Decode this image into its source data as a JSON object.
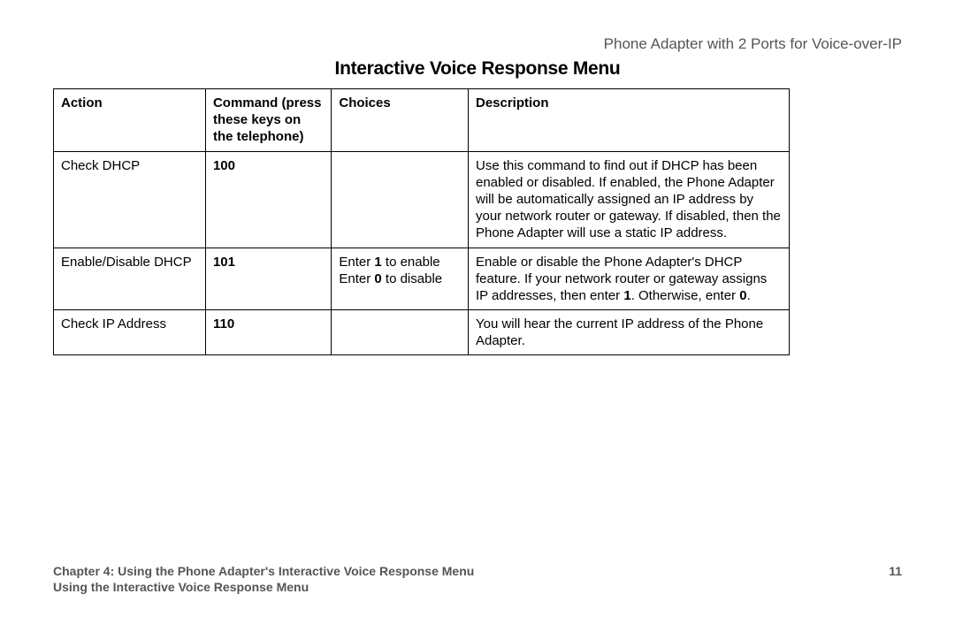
{
  "header": {
    "product": "Phone Adapter with 2 Ports for Voice-over-IP"
  },
  "title": "Interactive Voice Response Menu",
  "table": {
    "headers": {
      "action": "Action",
      "command": "Command (press these keys on the telephone)",
      "choices": "Choices",
      "description": "Description"
    },
    "rows": [
      {
        "action": "Check DHCP",
        "command": "100",
        "choices": "",
        "description": "Use this command to find out if DHCP has been enabled or disabled. If enabled, the Phone Adapter will be automatically assigned an IP address by your network router or gateway. If disabled, then the Phone Adapter will use a static IP address."
      },
      {
        "action": "Enable/Disable DHCP",
        "command": "101",
        "choices_parts": {
          "pre1": "Enter ",
          "b1": "1",
          "post1": " to enable\nEnter ",
          "b2": "0",
          "post2": " to disable"
        },
        "description_parts": {
          "pre": "Enable or disable the Phone Adapter's DHCP feature. If your network router or gateway assigns IP addresses, then enter ",
          "b1": "1",
          "mid": ". Otherwise, enter ",
          "b2": "0",
          "end": "."
        }
      },
      {
        "action": "Check IP Address",
        "command": "110",
        "choices": "",
        "description": "You will hear the current IP address of the Phone Adapter."
      }
    ]
  },
  "footer": {
    "chapter": "Chapter 4: Using the Phone Adapter's Interactive Voice Response Menu",
    "page": "11",
    "section": "Using the Interactive Voice Response Menu"
  }
}
